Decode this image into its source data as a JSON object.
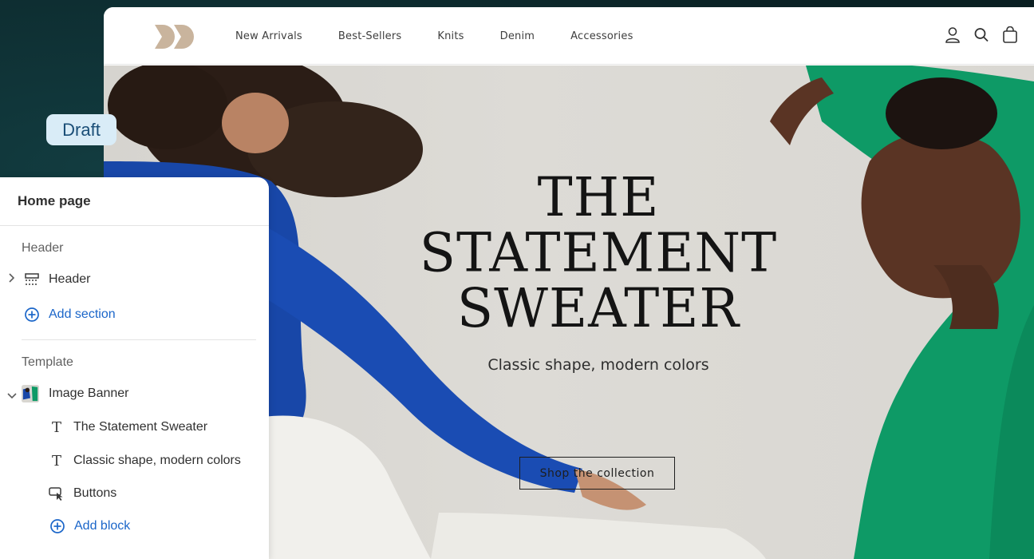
{
  "store": {
    "nav": [
      "New Arrivals",
      "Best-Sellers",
      "Knits",
      "Denim",
      "Accessories"
    ],
    "icons": [
      "account-icon",
      "search-icon",
      "cart-icon"
    ]
  },
  "hero": {
    "title_lines": [
      "THE",
      "STATEMENT",
      "SWEATER"
    ],
    "subtitle": "Classic shape, modern colors",
    "button": "Shop the collection"
  },
  "badge": {
    "label": "Draft"
  },
  "panel": {
    "title": "Home page",
    "header_group": "Header",
    "header_item": "Header",
    "add_section": "Add section",
    "template_group": "Template",
    "image_banner": "Image Banner",
    "blocks": [
      "The Statement Sweater",
      "Classic shape, modern colors",
      "Buttons"
    ],
    "add_block": "Add block"
  },
  "colors": {
    "background": "#0d2b2e",
    "link": "#1b66c9",
    "badge_bg": "#d9ecf7",
    "badge_text": "#1a4e77",
    "blue_sweater": "#1847a8",
    "green_sweater": "#0e9a66"
  }
}
